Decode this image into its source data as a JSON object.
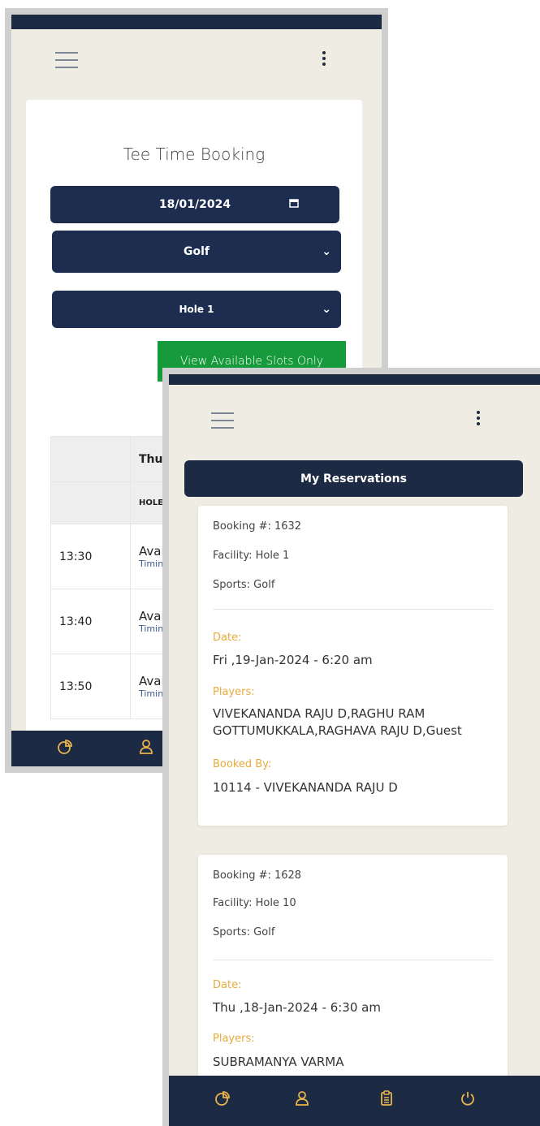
{
  "booking": {
    "title": "Tee Time Booking",
    "date_value": "18/01/2024",
    "sport_selected": "Golf",
    "facility_selected": "Hole 1",
    "view_slots_label": "View Available Slots Only",
    "table_day_header": "Thu",
    "table_col_header": "HOLE",
    "rows": [
      {
        "time": "13:30",
        "status": "Avail",
        "sub": "Timin"
      },
      {
        "time": "13:40",
        "status": "Avail",
        "sub": "Timin"
      },
      {
        "time": "13:50",
        "status": "Avail",
        "sub": "Timin"
      }
    ]
  },
  "icons": {
    "calendar": "calendar-icon",
    "dropdown": "chevron-down-icon",
    "menu": "menu-icon",
    "more": "more-vertical-icon",
    "dashboard": "pie-chart-icon",
    "profile": "user-icon",
    "reservations": "clipboard-icon",
    "logout": "power-icon"
  },
  "reservations": {
    "title": "My Reservations",
    "date_label": "Date:",
    "players_label": "Players:",
    "booked_by_label": "Booked By:",
    "items": [
      {
        "booking": "Booking #: 1632",
        "facility": "Facility: Hole 1",
        "sports": "Sports: Golf",
        "date": "Fri ,19-Jan-2024 - 6:20 am",
        "players": "VIVEKANANDA RAJU D,RAGHU RAM GOTTUMUKKALA,RAGHAVA RAJU D,Guest",
        "booked_by": "10114 - VIVEKANANDA RAJU D"
      },
      {
        "booking": "Booking #: 1628",
        "facility": "Facility: Hole 10",
        "sports": "Sports: Golf",
        "date": "Thu ,18-Jan-2024 - 6:30 am",
        "players": "SUBRAMANYA VARMA"
      }
    ]
  },
  "colors": {
    "navy": "#1d2d50",
    "green": "#169a3c",
    "accent": "#e7ab3b",
    "background": "#efede3"
  }
}
